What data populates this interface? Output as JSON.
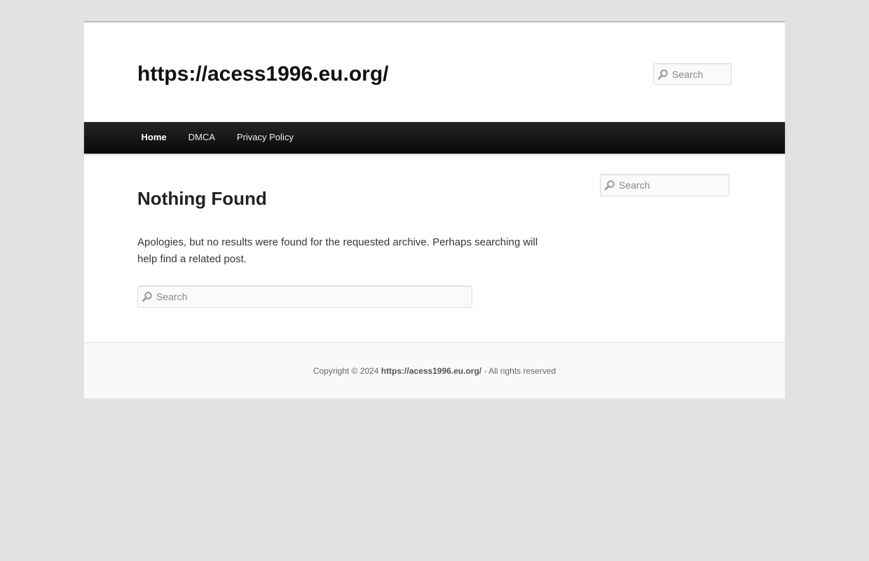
{
  "header": {
    "site_title": "https://acess1996.eu.org/",
    "search_placeholder": "Search"
  },
  "nav": {
    "items": [
      {
        "label": "Home",
        "current": true
      },
      {
        "label": "DMCA",
        "current": false
      },
      {
        "label": "Privacy Policy",
        "current": false
      }
    ]
  },
  "content": {
    "title": "Nothing Found",
    "message": "Apologies, but no results were found for the requested archive. Perhaps searching will help find a related post.",
    "search_placeholder": "Search"
  },
  "sidebar": {
    "search_placeholder": "Search"
  },
  "footer": {
    "copyright_prefix": "Copyright © 2024",
    "site_link": "https://acess1996.eu.org/",
    "suffix": "- All rights reserved"
  },
  "icons": {
    "search": "magnifier-icon"
  },
  "colors": {
    "background": "#e2e2e2",
    "page": "#ffffff",
    "nav_bar": "#111111",
    "footer": "#f9f9f9"
  }
}
